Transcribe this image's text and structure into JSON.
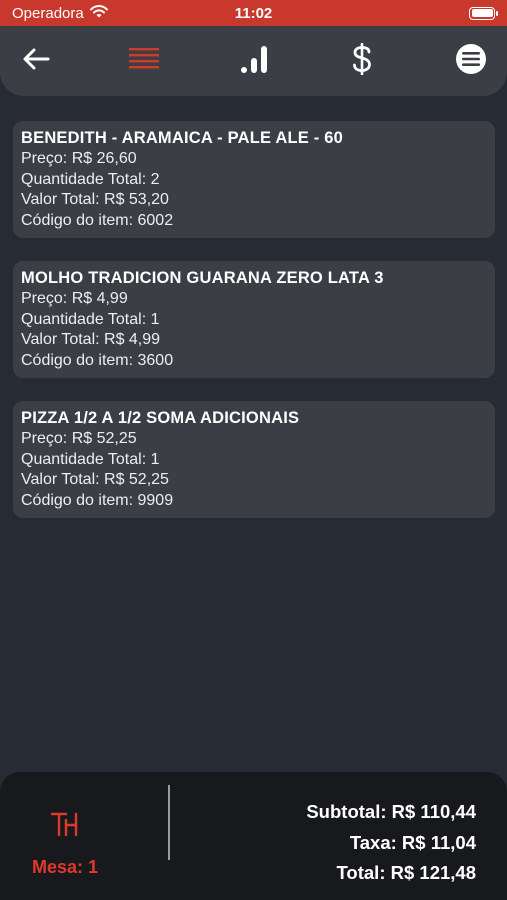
{
  "status_bar": {
    "carrier": "Operadora",
    "time": "11:02"
  },
  "nav": {
    "icons": [
      "back-arrow-icon",
      "list-icon",
      "chart-bars-icon",
      "dollar-icon",
      "menu-circle-icon"
    ],
    "active": "list-icon",
    "active_color": "#d0392c"
  },
  "items": [
    {
      "name": "BENEDITH - ARAMAICA - PALE ALE - 60",
      "preco": "Preço: R$ 26,60",
      "quantidade": "Quantidade Total: 2",
      "valor": "Valor Total: R$ 53,20",
      "codigo": "Código do item: 6002"
    },
    {
      "name": "MOLHO TRADICION GUARANA ZERO LATA 3",
      "preco": "Preço: R$ 4,99",
      "quantidade": "Quantidade Total: 1",
      "valor": "Valor Total: R$ 4,99",
      "codigo": "Código do item: 3600"
    },
    {
      "name": "PIZZA 1/2 A 1/2 SOMA ADICIONAIS",
      "preco": "Preço: R$ 52,25",
      "quantidade": "Quantidade Total: 1",
      "valor": "Valor Total: R$ 52,25",
      "codigo": "Código do item: 9909"
    }
  ],
  "footer": {
    "mesa": "Mesa: 1",
    "subtotal": "Subtotal: R$ 110,44",
    "taxa": "Taxa: R$ 11,04",
    "total": "Total: R$ 121,48",
    "accent_color": "#e0392c"
  }
}
